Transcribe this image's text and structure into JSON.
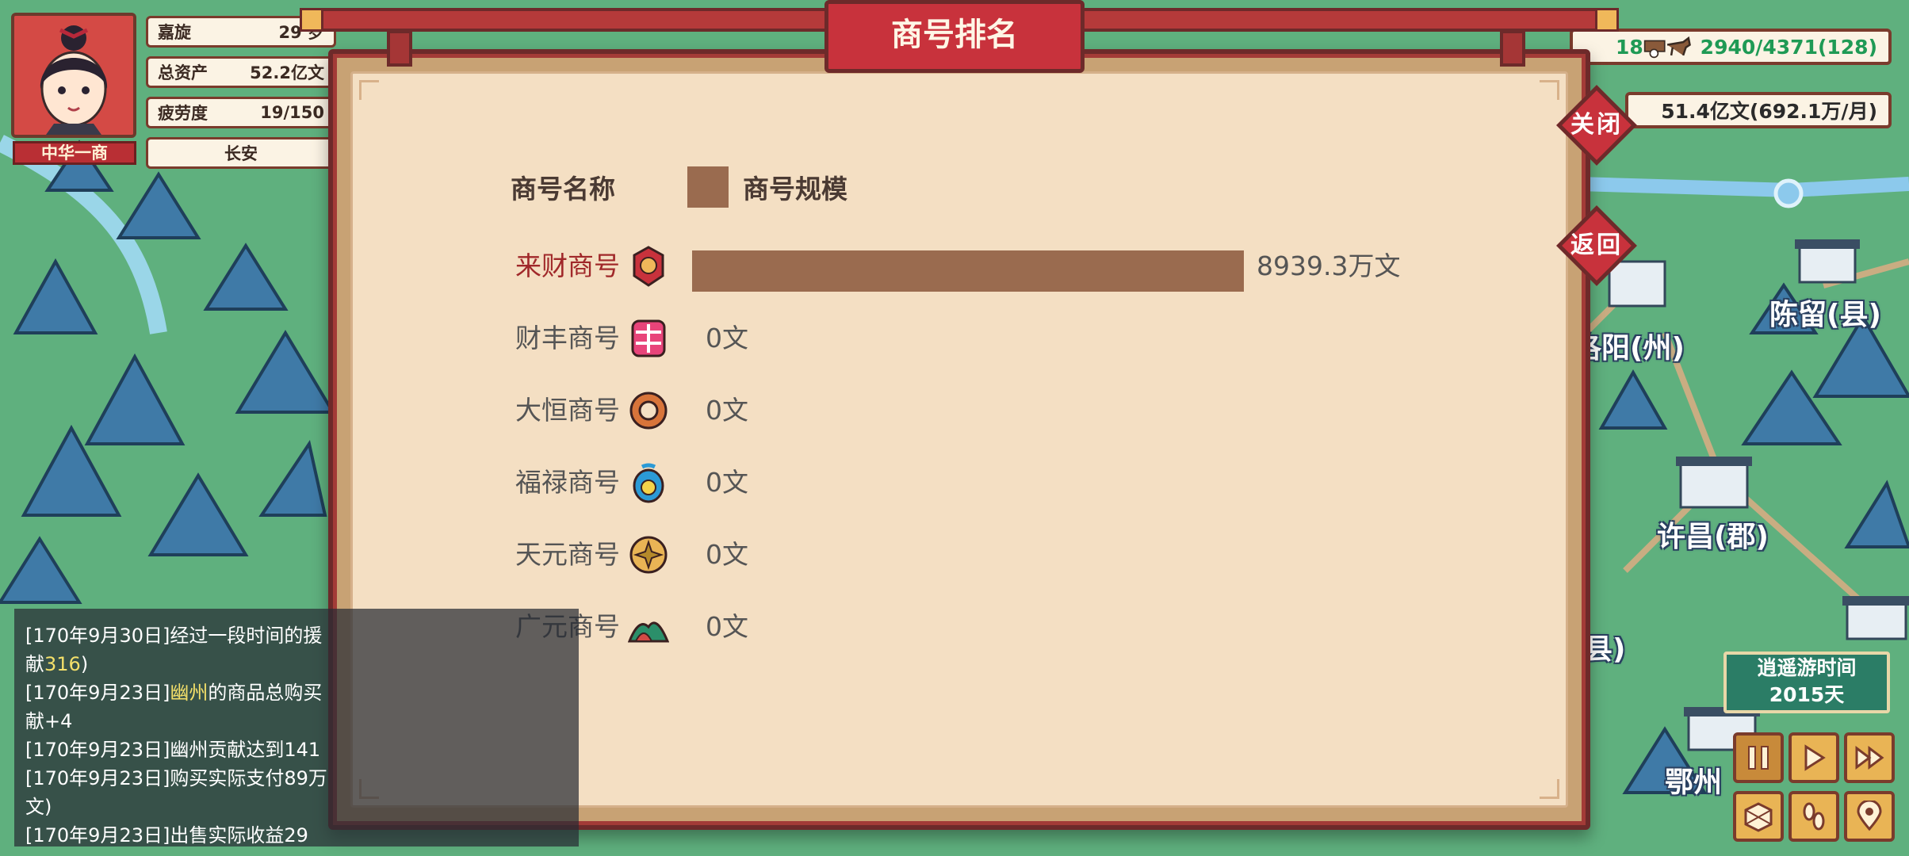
{
  "player": {
    "name": "嘉旋",
    "age": "29 岁",
    "assets_label": "总资产",
    "assets_value": "52.2亿文",
    "fatigue_label": "疲劳度",
    "fatigue_value": "19/150",
    "city": "长安",
    "title": "中华一商"
  },
  "resources": {
    "left_value": "18",
    "caravan": "2940/4371(128)",
    "money": "51.4亿文(692.1万/月)"
  },
  "modal": {
    "title": "商号排名",
    "close_label": "关闭",
    "back_label": "返回",
    "legend": {
      "name_header": "商号名称",
      "scale_header": "商号规模",
      "swatch_color": "#9a6b4f"
    }
  },
  "chart_data": {
    "type": "bar",
    "orientation": "horizontal",
    "xlabel": "商号名称",
    "series": [
      {
        "name": "商号规模",
        "values": [
          89393000,
          0,
          0,
          0,
          0,
          0
        ]
      }
    ],
    "categories": [
      "来财商号",
      "财丰商号",
      "大恒商号",
      "福禄商号",
      "天元商号",
      "广元商号"
    ],
    "value_labels": [
      "8939.3万文",
      "0文",
      "0文",
      "0文",
      "0文",
      "0文"
    ],
    "bar_color": "#9a6b4f",
    "highlight_color": "#a0282a",
    "highlight_index": 0
  },
  "badges": [
    "lantern-badge-icon",
    "coin-cross-badge-icon",
    "ring-badge-icon",
    "blue-gourd-badge-icon",
    "gold-emblem-badge-icon",
    "mountain-badge-icon"
  ],
  "log": [
    {
      "pre": "[170年9月30日]经过一段时间的援",
      "hl": "",
      "post": ""
    },
    {
      "pre": "献",
      "hl": "316",
      "post": ")"
    },
    {
      "pre": "[170年9月23日]",
      "hl": "幽州",
      "post": "的商品总购买"
    },
    {
      "pre": "献+4",
      "hl": "",
      "post": ""
    },
    {
      "pre": "[170年9月23日]幽州贡献达到141",
      "hl": "",
      "post": ""
    },
    {
      "pre": "[170年9月23日]购买实际支付89万",
      "hl": "",
      "post": ""
    },
    {
      "pre": "文)",
      "hl": "",
      "post": ""
    },
    {
      "pre": "[170年9月23日]出售实际收益29",
      "hl": "",
      "post": ""
    }
  ],
  "timer": {
    "label": "逍遥游时间",
    "days": "2015天"
  },
  "map_labels": {
    "chenliu": "陈留(县)",
    "luoyang": "洛阳(州)",
    "xuchang": "许昌(郡)",
    "xian_partial": "县)",
    "ezhou": "鄂州"
  }
}
